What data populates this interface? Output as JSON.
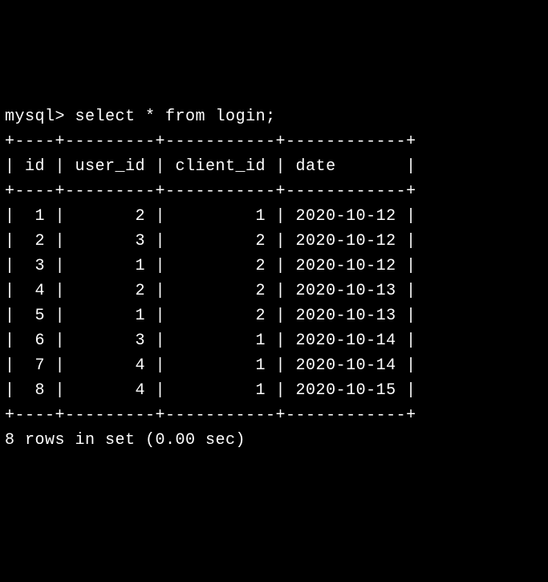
{
  "prompt": "mysql>",
  "query": "select * from login;",
  "chart_data": {
    "type": "table",
    "columns": [
      "id",
      "user_id",
      "client_id",
      "date"
    ],
    "rows": [
      {
        "id": 1,
        "user_id": 2,
        "client_id": 1,
        "date": "2020-10-12"
      },
      {
        "id": 2,
        "user_id": 3,
        "client_id": 2,
        "date": "2020-10-12"
      },
      {
        "id": 3,
        "user_id": 1,
        "client_id": 2,
        "date": "2020-10-12"
      },
      {
        "id": 4,
        "user_id": 2,
        "client_id": 2,
        "date": "2020-10-13"
      },
      {
        "id": 5,
        "user_id": 1,
        "client_id": 2,
        "date": "2020-10-13"
      },
      {
        "id": 6,
        "user_id": 3,
        "client_id": 1,
        "date": "2020-10-14"
      },
      {
        "id": 7,
        "user_id": 4,
        "client_id": 1,
        "date": "2020-10-14"
      },
      {
        "id": 8,
        "user_id": 4,
        "client_id": 1,
        "date": "2020-10-15"
      }
    ]
  },
  "col_widths": {
    "id": 4,
    "user_id": 9,
    "client_id": 11,
    "date": 12
  },
  "footer": "8 rows in set (0.00 sec)"
}
